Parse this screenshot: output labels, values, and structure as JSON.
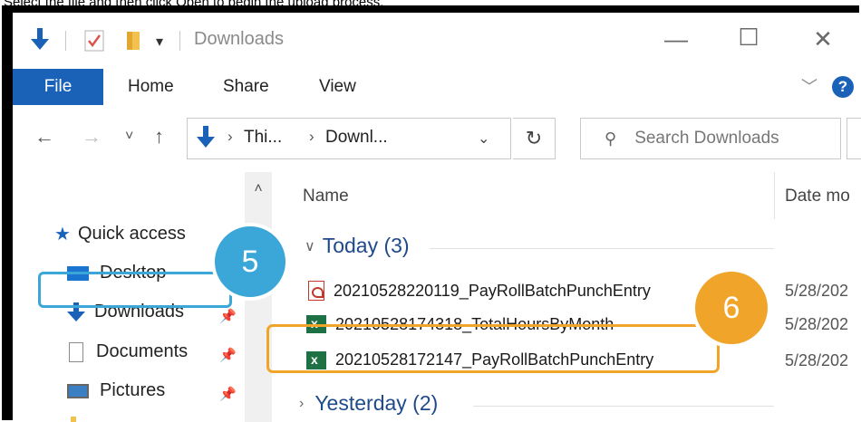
{
  "caption": "Select the file and then click Open to begin the upload process.",
  "window": {
    "title": "Downloads",
    "controls": {
      "minimize": "—",
      "maximize": "☐",
      "close": "✕"
    }
  },
  "ribbon": {
    "tabs": [
      {
        "label": "File",
        "active": true
      },
      {
        "label": "Home"
      },
      {
        "label": "Share"
      },
      {
        "label": "View"
      }
    ],
    "help_label": "?"
  },
  "nav": {
    "breadcrumb": [
      "Thi...",
      "Downl..."
    ],
    "search_placeholder": "Search Downloads"
  },
  "sidebar": {
    "quick_access_label": "Quick access",
    "items": [
      {
        "label": "Desktop"
      },
      {
        "label": "Downloads"
      },
      {
        "label": "Documents"
      },
      {
        "label": "Pictures"
      }
    ]
  },
  "columns": {
    "name": "Name",
    "date": "Date mo"
  },
  "groups": {
    "today": "Today (3)",
    "yesterday": "Yesterday (2)"
  },
  "files": [
    {
      "name": "20210528220119_PayRollBatchPunchEntry",
      "date": "5/28/202",
      "type": "pdf"
    },
    {
      "name": "20210528174318_TotalHoursByMonth",
      "date": "5/28/202",
      "type": "xlsx"
    },
    {
      "name": "20210528172147_PayRollBatchPunchEntry",
      "date": "5/28/202",
      "type": "xlsx"
    }
  ],
  "steps": {
    "step5": "5",
    "step6": "6"
  },
  "colors": {
    "accent": "#1a62b8",
    "step5": "#3ba7d8",
    "step6": "#f0a52a"
  }
}
